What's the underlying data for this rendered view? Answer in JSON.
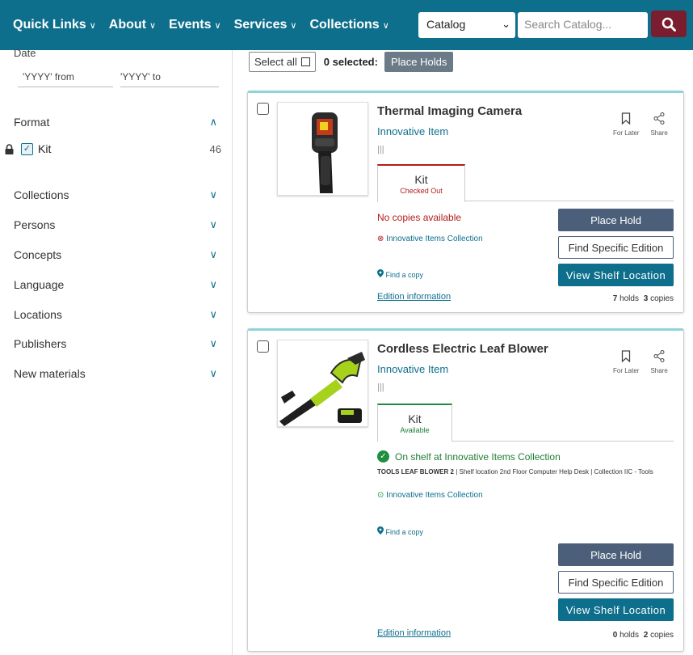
{
  "nav": {
    "items": [
      "Quick Links",
      "About",
      "Events",
      "Services",
      "Collections"
    ],
    "catalog_select": "Catalog",
    "search_placeholder": "Search Catalog..."
  },
  "sidebar": {
    "date_heading": "Date",
    "date_from_placeholder": "'YYYY' from",
    "date_to_placeholder": "'YYYY' to",
    "format_label": "Format",
    "kit_label": "Kit",
    "kit_count": "46",
    "facets": [
      "Collections",
      "Persons",
      "Concepts",
      "Language",
      "Locations",
      "Publishers",
      "New materials"
    ]
  },
  "toolbar": {
    "select_all": "Select all",
    "selected": "0 selected:",
    "place_holds": "Place Holds"
  },
  "common": {
    "for_later": "For Later",
    "share": "Share",
    "find_copy": "Find a copy",
    "edition_info": "Edition information",
    "place_hold": "Place Hold",
    "find_edition": "Find Specific Edition",
    "view_shelf": "View Shelf Location",
    "bars": "|||"
  },
  "results": [
    {
      "title": "Thermal Imaging Camera",
      "subtitle": "Innovative Item",
      "format": "Kit",
      "format_status": "Checked Out",
      "availability": "No copies available",
      "collection": "Innovative Items Collection",
      "holds_num": "7",
      "holds_label": "holds",
      "copies_num": "3",
      "copies_label": "copies"
    },
    {
      "title": "Cordless Electric Leaf Blower",
      "subtitle": "Innovative Item",
      "format": "Kit",
      "format_status": "Available",
      "availability": "On shelf at Innovative Items Collection",
      "shelf_bold": "TOOLS LEAF BLOWER 2",
      "shelf_rest": " | Shelf location 2nd Floor Computer Help Desk | Collection IIC - Tools",
      "collection": "Innovative Items Collection",
      "holds_num": "0",
      "holds_label": "holds",
      "copies_num": "2",
      "copies_label": "copies"
    }
  ],
  "colors": {
    "nav_bg": "#0e6f8c",
    "search_btn": "#7a1d2e",
    "place_hold": "#4c5f7a",
    "checked_out": "#b31b1b",
    "available": "#1e7d33"
  }
}
